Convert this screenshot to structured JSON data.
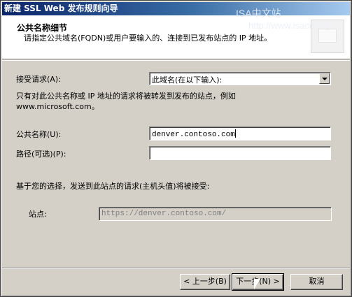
{
  "window": {
    "title": "新建 SSL Web 发布规则向导"
  },
  "watermark": {
    "line1": "ISA中文站",
    "line2": "http://www.isacn.org"
  },
  "header": {
    "title": "公共名称细节",
    "subtitle": "请指定公共域名(FQDN)或用户要输入的、连接到已发布站点的 IP 地址。"
  },
  "accept": {
    "label": "接受请求(A):",
    "selected": "此域名(在以下输入):"
  },
  "info": {
    "text": "只有对此公共名称或 IP 地址的请求将被转发到发布的站点，例如 www.microsoft.com。"
  },
  "public_name": {
    "label": "公共名称(U):",
    "value": "denver.contoso.com"
  },
  "path": {
    "label": "路径(可选)(P):",
    "value": ""
  },
  "summary": {
    "text": "基于您的选择，发送到此站点的请求(主机头值)将被接受:"
  },
  "site": {
    "label": "站点:",
    "value": "https://denver.contoso.com/"
  },
  "buttons": {
    "back": "< 上一步(B)",
    "next": "下一步(N) >",
    "cancel": "取消"
  }
}
